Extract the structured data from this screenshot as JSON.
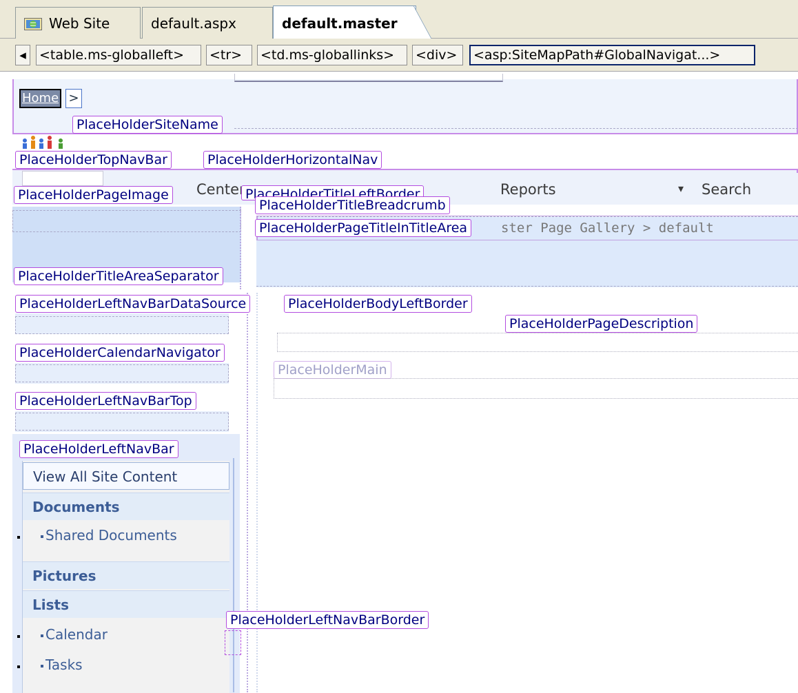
{
  "tabs": [
    {
      "label": "Web Site",
      "icon": "website-icon",
      "active": false
    },
    {
      "label": "default.aspx",
      "active": false
    },
    {
      "label": "default.master",
      "active": true
    }
  ],
  "tag_selector": {
    "scroll_left": "◂",
    "tags": [
      "<table.ms-globalleft>",
      "<tr>",
      "<td.ms-globallinks>",
      "<div>",
      "<asp:SiteMapPath#GlobalNavigat...>"
    ]
  },
  "breadcrumb": {
    "home": "Home",
    "separator": ">"
  },
  "top_nav": {
    "center_fragment": "Center",
    "reports": "Reports",
    "dropdown_glyph": "▾",
    "search": "Search"
  },
  "title_area": {
    "page_title_fragment": "ster Page Gallery > default"
  },
  "placeholders": {
    "site_name": "PlaceHolderSiteName",
    "top_nav_bar": "PlaceHolderTopNavBar",
    "horizontal_nav": "PlaceHolderHorizontalNav",
    "page_image": "PlaceHolderPageImage",
    "title_left_border": "PlaceHolderTitleLeftBorder",
    "title_breadcrumb": "PlaceHolderTitleBreadcrumb",
    "page_title_in_title_area": "PlaceHolderPageTitleInTitleArea",
    "title_area_separator": "PlaceHolderTitleAreaSeparator",
    "left_nav_bar_data_source": "PlaceHolderLeftNavBarDataSource",
    "body_left_border": "PlaceHolderBodyLeftBorder",
    "page_description": "PlaceHolderPageDescription",
    "calendar_navigator": "PlaceHolderCalendarNavigator",
    "main": "PlaceHolderMain",
    "left_nav_bar_top": "PlaceHolderLeftNavBarTop",
    "left_nav_bar": "PlaceHolderLeftNavBar",
    "left_nav_bar_border": "PlaceHolderLeftNavBarBorder"
  },
  "left_nav": {
    "view_all": "View All Site Content",
    "documents": "Documents",
    "shared_documents": "Shared Documents",
    "pictures": "Pictures",
    "lists": "Lists",
    "calendar": "Calendar",
    "tasks": "Tasks"
  },
  "colors": {
    "chrome": "#ece9d8",
    "placeholder_border": "#b34de0",
    "placeholder_text": "#000080",
    "title_band": "#dde9fb"
  }
}
